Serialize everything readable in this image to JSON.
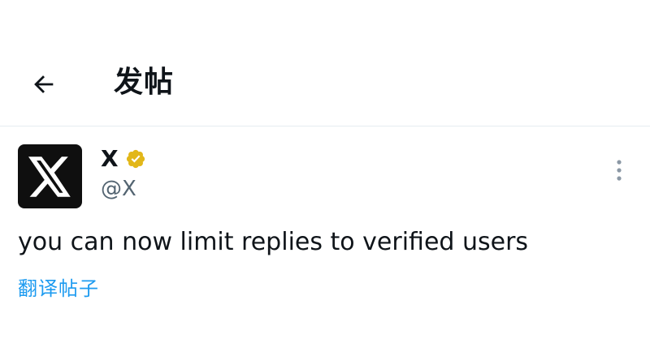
{
  "header": {
    "back_icon": "arrow-left-icon",
    "title": "发帖"
  },
  "post": {
    "author": {
      "avatar_icon": "x-logo-icon",
      "display_name": "X",
      "verified_badge_icon": "gold-verified-check-icon",
      "handle": "@X"
    },
    "more_icon": "more-vertical-icon",
    "text": "you can now limit replies to verified users",
    "translate_link": "翻译帖子"
  },
  "colors": {
    "text_primary": "#0f1419",
    "text_secondary": "#536471",
    "link": "#1d9bf0",
    "verified_gold": "#e2b719",
    "divider": "#e6ecf0",
    "avatar_bg": "#0f0f0f"
  }
}
